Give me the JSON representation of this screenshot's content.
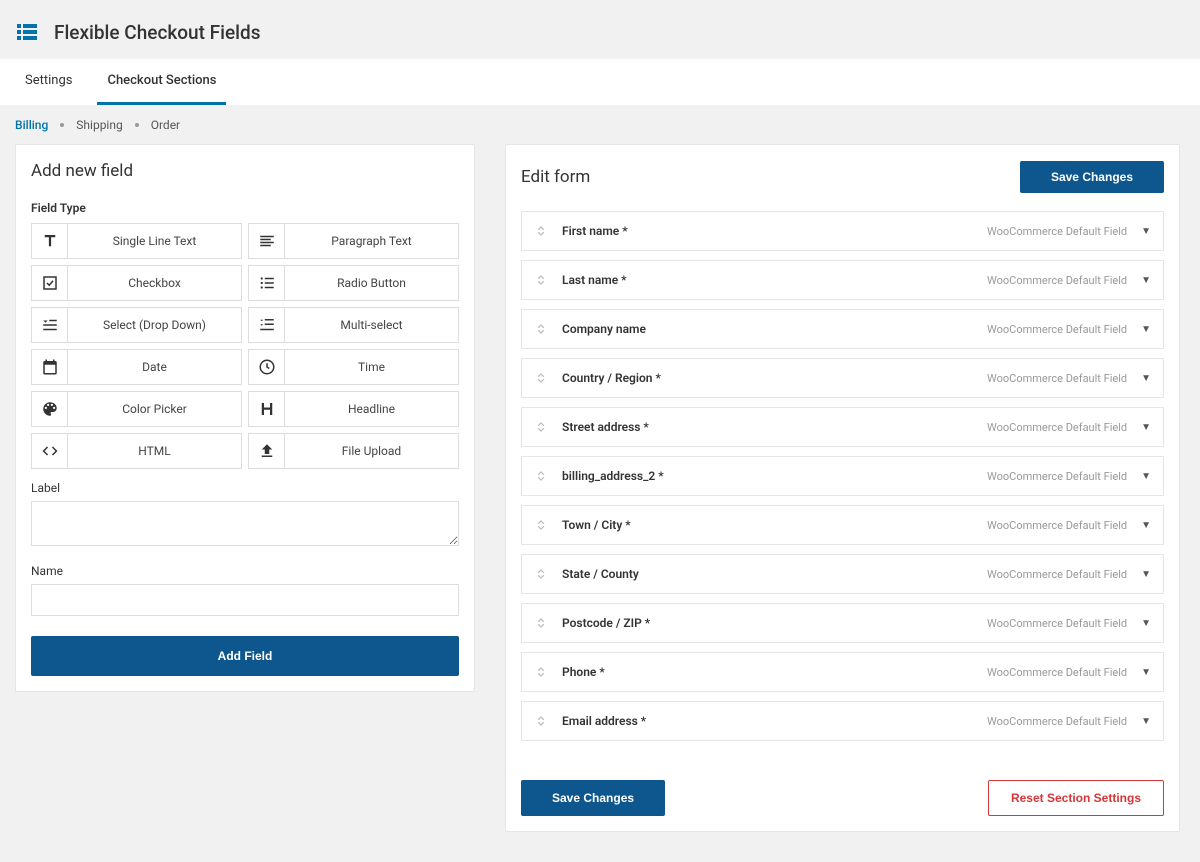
{
  "page_title": "Flexible Checkout Fields",
  "tabs": [
    {
      "label": "Settings",
      "active": false
    },
    {
      "label": "Checkout Sections",
      "active": true
    }
  ],
  "sub_nav": [
    {
      "label": "Billing",
      "active": true
    },
    {
      "label": "Shipping",
      "active": false
    },
    {
      "label": "Order",
      "active": false
    }
  ],
  "left_panel": {
    "title": "Add new field",
    "field_type_label": "Field Type",
    "field_types": [
      {
        "label": "Single Line Text",
        "icon": "text"
      },
      {
        "label": "Paragraph Text",
        "icon": "paragraph"
      },
      {
        "label": "Checkbox",
        "icon": "checkbox"
      },
      {
        "label": "Radio Button",
        "icon": "list"
      },
      {
        "label": "Select (Drop Down)",
        "icon": "select"
      },
      {
        "label": "Multi-select",
        "icon": "multiselect"
      },
      {
        "label": "Date",
        "icon": "calendar"
      },
      {
        "label": "Time",
        "icon": "clock"
      },
      {
        "label": "Color Picker",
        "icon": "palette"
      },
      {
        "label": "Headline",
        "icon": "headline"
      },
      {
        "label": "HTML",
        "icon": "code"
      },
      {
        "label": "File Upload",
        "icon": "upload"
      }
    ],
    "label_label": "Label",
    "name_label": "Name",
    "add_button": "Add Field"
  },
  "right_panel": {
    "title": "Edit form",
    "save_button": "Save Changes",
    "reset_button": "Reset Section Settings",
    "default_tag": "WooCommerce Default Field",
    "fields": [
      {
        "label": "First name *"
      },
      {
        "label": "Last name *"
      },
      {
        "label": "Company name"
      },
      {
        "label": "Country / Region *"
      },
      {
        "label": "Street address *"
      },
      {
        "label": "billing_address_2 *"
      },
      {
        "label": "Town / City *"
      },
      {
        "label": "State / County"
      },
      {
        "label": "Postcode / ZIP *"
      },
      {
        "label": "Phone *"
      },
      {
        "label": "Email address *"
      }
    ]
  }
}
